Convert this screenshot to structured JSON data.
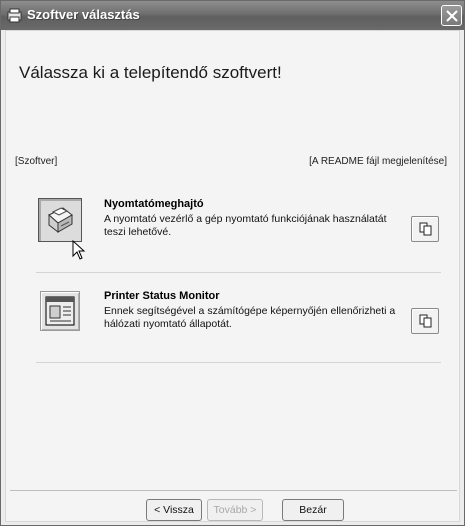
{
  "window": {
    "title": "Szoftver választás"
  },
  "main": {
    "heading": "Válassza ki a telepítendő szoftvert!",
    "column_left": "[Szoftver]",
    "column_right": "[A README fájl megjelenítése]"
  },
  "software": [
    {
      "title": "Nyomtatómeghajtó",
      "description": "A nyomtató vezérlő a gép nyomtató funkciójának használatát teszi lehetővé.",
      "icon": "printer-icon"
    },
    {
      "title": "Printer Status Monitor",
      "description": "Ennek segítségével a számítógépe képernyőjén ellenőrizheti a hálózati nyomtató állapotát.",
      "icon": "status-monitor-icon"
    }
  ],
  "buttons": {
    "back": "< Vissza",
    "next": "Tovább >",
    "close": "Bezár"
  }
}
